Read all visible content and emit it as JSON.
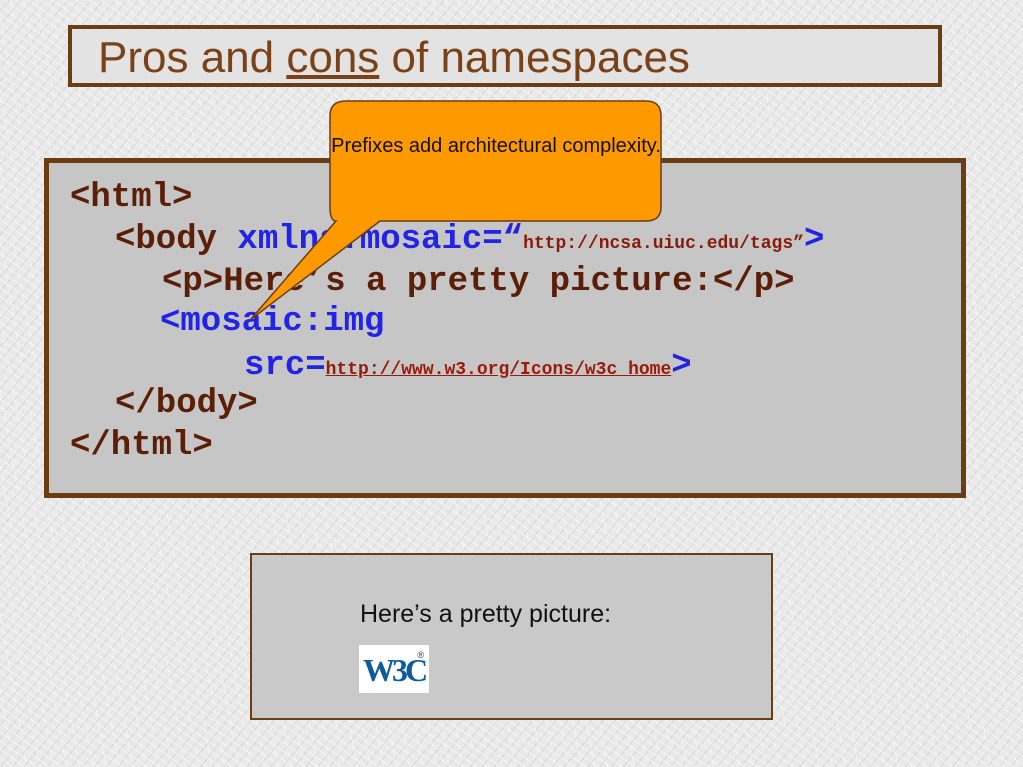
{
  "title": {
    "before": "Pros and ",
    "underlined": "cons",
    "after": " of namespaces"
  },
  "code": {
    "line1": "<html>",
    "line2_tag": "<body ",
    "line2_attr": "xmlns:mosaic=“",
    "line2_url": "http://ncsa.uiuc.edu/tags”",
    "line2_close": ">",
    "line3": "<p>Here’s a pretty picture:</p>",
    "line4": "<mosaic:img",
    "line5_attr": "src=",
    "line5_url": "http://www.w3.org/Icons/w3c_home",
    "line5_close": ">",
    "line6": "</body>",
    "line7": "</html>"
  },
  "callout": {
    "text": "Prefixes add architectural complexity."
  },
  "picture": {
    "label": "Here’s a pretty picture:",
    "logo_text": "W3C",
    "logo_reg": "®",
    "logo_icon": "w3c-logo-icon"
  },
  "colors": {
    "frame": "#6b3d12",
    "title": "#7a4216",
    "code_tag": "#5b1e06",
    "code_attr": "#2323e6",
    "callout_fill": "#ff9900",
    "w3c_blue": "#0d5b9c"
  }
}
